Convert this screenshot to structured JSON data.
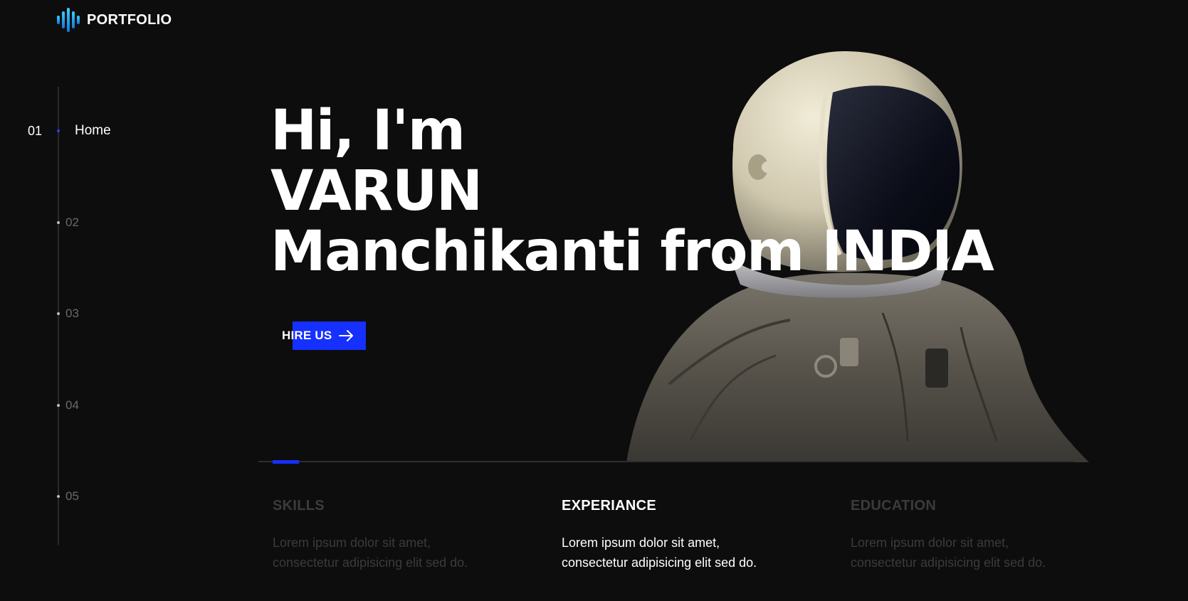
{
  "brand": {
    "name": "PORTFOLIO",
    "icon": "sound-wave-logo-icon",
    "accent": "#1530ff"
  },
  "side_nav": {
    "items": [
      {
        "number": "01",
        "label": "Home",
        "active": true
      },
      {
        "number": "02",
        "label": "",
        "active": false
      },
      {
        "number": "03",
        "label": "",
        "active": false
      },
      {
        "number": "04",
        "label": "",
        "active": false
      },
      {
        "number": "05",
        "label": "",
        "active": false
      }
    ]
  },
  "hero": {
    "line1": "Hi, I'm",
    "line2": "VARUN",
    "line3": "Manchikanti from INDIA",
    "cta_label": "HIRE US",
    "cta_icon": "arrow-right-icon",
    "image": "astronaut-image"
  },
  "features": [
    {
      "title": "SKILLS",
      "text_line1": "Lorem ipsum dolor sit amet,",
      "text_line2": "consectetur adipisicing elit sed do.",
      "active": false
    },
    {
      "title": "EXPERIANCE",
      "text_line1": "Lorem ipsum dolor sit amet,",
      "text_line2": "consectetur adipisicing elit sed do.",
      "active": true
    },
    {
      "title": "EDUCATION",
      "text_line1": "Lorem ipsum dolor sit amet,",
      "text_line2": "consectetur adipisicing elit sed do.",
      "active": false
    }
  ]
}
